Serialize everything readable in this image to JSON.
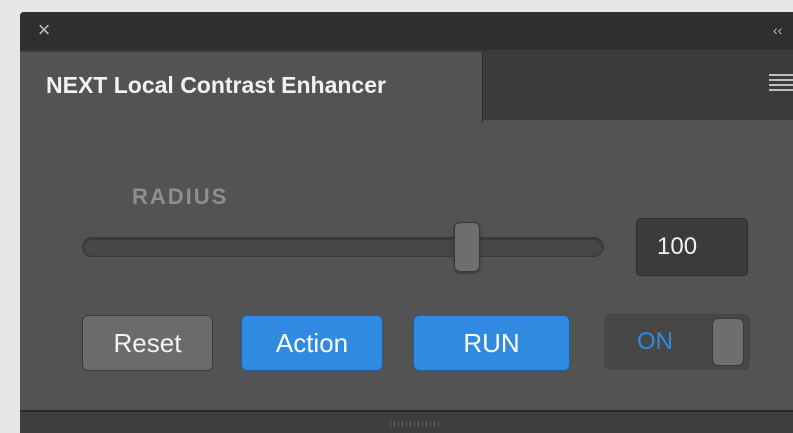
{
  "window": {
    "close_icon": "close-icon",
    "collapse_icon": "collapse-chevrons-icon"
  },
  "tab": {
    "title": "NEXT Local Contrast Enhancer",
    "menu_icon": "panel-menu-icon"
  },
  "radius": {
    "label": "RADIUS",
    "value": "100",
    "slider_fraction": 0.74
  },
  "buttons": {
    "reset_label": "Reset",
    "action_label": "Action",
    "run_label": "RUN"
  },
  "toggle": {
    "label": "ON",
    "state": "on"
  },
  "colors": {
    "panel_bg": "#535353",
    "accent_blue": "#2f8ae0"
  }
}
